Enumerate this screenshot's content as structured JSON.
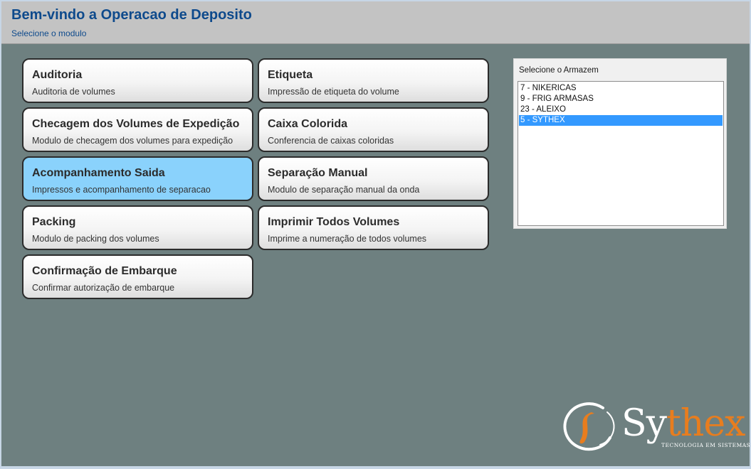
{
  "header": {
    "title": "Bem-vindo a Operacao de Deposito",
    "subtitle": "Selecione o modulo"
  },
  "modules": [
    {
      "title": "Auditoria",
      "description": "Auditoria de volumes"
    },
    {
      "title": "Etiqueta",
      "description": "Impressão de etiqueta do volume"
    },
    {
      "title": "Checagem dos Volumes de Expedição",
      "description": "Modulo de checagem dos volumes para expedição"
    },
    {
      "title": "Caixa Colorida",
      "description": "Conferencia de caixas coloridas"
    },
    {
      "title": "Acompanhamento Saida",
      "description": "Impressos e acompanhamento de separacao",
      "active": true
    },
    {
      "title": "Separação Manual",
      "description": "Modulo de separação manual da onda"
    },
    {
      "title": "Packing",
      "description": "Modulo de packing dos volumes"
    },
    {
      "title": "Imprimir Todos Volumes",
      "description": "Imprime a numeração de todos volumes"
    },
    {
      "title": "Confirmação de Embarque",
      "description": "Confirmar autorização de embarque"
    }
  ],
  "warehouse": {
    "label": "Selecione o Armazem",
    "items": [
      "7 - NIKERICAS",
      "9 - FRIG ARMASAS",
      "23 - ALEIXO",
      "5 - SYTHEX"
    ],
    "selected_index": 3
  },
  "logo": {
    "text_part1": "Sy",
    "text_part2": "thex",
    "tagline": "TECNOLOGIA EM SISTEMAS",
    "accent_color": "#e87d1e"
  },
  "colors": {
    "background": "#6e8080",
    "header": "#c3c3c3",
    "title": "#0e4a8c",
    "active_tile": "#8ad2fc",
    "selection": "#3399ff"
  }
}
